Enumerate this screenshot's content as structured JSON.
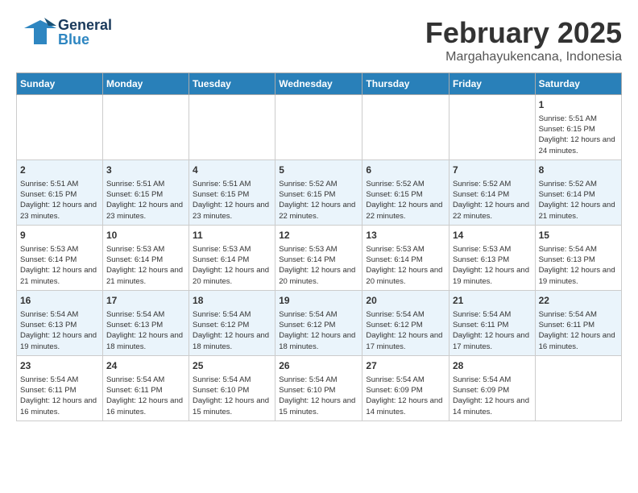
{
  "header": {
    "logo_general": "General",
    "logo_blue": "Blue",
    "month_title": "February 2025",
    "subtitle": "Margahayukencana, Indonesia"
  },
  "days_of_week": [
    "Sunday",
    "Monday",
    "Tuesday",
    "Wednesday",
    "Thursday",
    "Friday",
    "Saturday"
  ],
  "weeks": [
    [
      {
        "day": "",
        "info": ""
      },
      {
        "day": "",
        "info": ""
      },
      {
        "day": "",
        "info": ""
      },
      {
        "day": "",
        "info": ""
      },
      {
        "day": "",
        "info": ""
      },
      {
        "day": "",
        "info": ""
      },
      {
        "day": "1",
        "info": "Sunrise: 5:51 AM\nSunset: 6:15 PM\nDaylight: 12 hours and 24 minutes."
      }
    ],
    [
      {
        "day": "2",
        "info": "Sunrise: 5:51 AM\nSunset: 6:15 PM\nDaylight: 12 hours and 23 minutes."
      },
      {
        "day": "3",
        "info": "Sunrise: 5:51 AM\nSunset: 6:15 PM\nDaylight: 12 hours and 23 minutes."
      },
      {
        "day": "4",
        "info": "Sunrise: 5:51 AM\nSunset: 6:15 PM\nDaylight: 12 hours and 23 minutes."
      },
      {
        "day": "5",
        "info": "Sunrise: 5:52 AM\nSunset: 6:15 PM\nDaylight: 12 hours and 22 minutes."
      },
      {
        "day": "6",
        "info": "Sunrise: 5:52 AM\nSunset: 6:15 PM\nDaylight: 12 hours and 22 minutes."
      },
      {
        "day": "7",
        "info": "Sunrise: 5:52 AM\nSunset: 6:14 PM\nDaylight: 12 hours and 22 minutes."
      },
      {
        "day": "8",
        "info": "Sunrise: 5:52 AM\nSunset: 6:14 PM\nDaylight: 12 hours and 21 minutes."
      }
    ],
    [
      {
        "day": "9",
        "info": "Sunrise: 5:53 AM\nSunset: 6:14 PM\nDaylight: 12 hours and 21 minutes."
      },
      {
        "day": "10",
        "info": "Sunrise: 5:53 AM\nSunset: 6:14 PM\nDaylight: 12 hours and 21 minutes."
      },
      {
        "day": "11",
        "info": "Sunrise: 5:53 AM\nSunset: 6:14 PM\nDaylight: 12 hours and 20 minutes."
      },
      {
        "day": "12",
        "info": "Sunrise: 5:53 AM\nSunset: 6:14 PM\nDaylight: 12 hours and 20 minutes."
      },
      {
        "day": "13",
        "info": "Sunrise: 5:53 AM\nSunset: 6:14 PM\nDaylight: 12 hours and 20 minutes."
      },
      {
        "day": "14",
        "info": "Sunrise: 5:53 AM\nSunset: 6:13 PM\nDaylight: 12 hours and 19 minutes."
      },
      {
        "day": "15",
        "info": "Sunrise: 5:54 AM\nSunset: 6:13 PM\nDaylight: 12 hours and 19 minutes."
      }
    ],
    [
      {
        "day": "16",
        "info": "Sunrise: 5:54 AM\nSunset: 6:13 PM\nDaylight: 12 hours and 19 minutes."
      },
      {
        "day": "17",
        "info": "Sunrise: 5:54 AM\nSunset: 6:13 PM\nDaylight: 12 hours and 18 minutes."
      },
      {
        "day": "18",
        "info": "Sunrise: 5:54 AM\nSunset: 6:12 PM\nDaylight: 12 hours and 18 minutes."
      },
      {
        "day": "19",
        "info": "Sunrise: 5:54 AM\nSunset: 6:12 PM\nDaylight: 12 hours and 18 minutes."
      },
      {
        "day": "20",
        "info": "Sunrise: 5:54 AM\nSunset: 6:12 PM\nDaylight: 12 hours and 17 minutes."
      },
      {
        "day": "21",
        "info": "Sunrise: 5:54 AM\nSunset: 6:11 PM\nDaylight: 12 hours and 17 minutes."
      },
      {
        "day": "22",
        "info": "Sunrise: 5:54 AM\nSunset: 6:11 PM\nDaylight: 12 hours and 16 minutes."
      }
    ],
    [
      {
        "day": "23",
        "info": "Sunrise: 5:54 AM\nSunset: 6:11 PM\nDaylight: 12 hours and 16 minutes."
      },
      {
        "day": "24",
        "info": "Sunrise: 5:54 AM\nSunset: 6:11 PM\nDaylight: 12 hours and 16 minutes."
      },
      {
        "day": "25",
        "info": "Sunrise: 5:54 AM\nSunset: 6:10 PM\nDaylight: 12 hours and 15 minutes."
      },
      {
        "day": "26",
        "info": "Sunrise: 5:54 AM\nSunset: 6:10 PM\nDaylight: 12 hours and 15 minutes."
      },
      {
        "day": "27",
        "info": "Sunrise: 5:54 AM\nSunset: 6:09 PM\nDaylight: 12 hours and 14 minutes."
      },
      {
        "day": "28",
        "info": "Sunrise: 5:54 AM\nSunset: 6:09 PM\nDaylight: 12 hours and 14 minutes."
      },
      {
        "day": "",
        "info": ""
      }
    ]
  ]
}
